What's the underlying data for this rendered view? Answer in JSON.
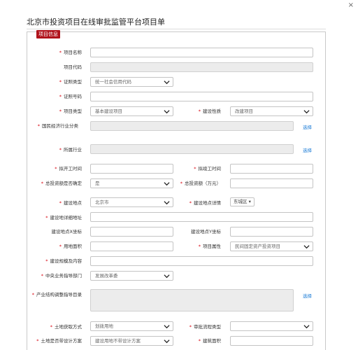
{
  "page_title": "北京市投资项目在线审批监管平台项目单",
  "section_tag": "项目信息",
  "close_label": "×",
  "fields": {
    "project_name": {
      "label": "项目名称",
      "value": ""
    },
    "project_code": {
      "label": "项目代码",
      "value": ""
    },
    "cert_type": {
      "label": "证照类型",
      "value": "统一社会信用代码"
    },
    "cert_no": {
      "label": "证照号码",
      "value": ""
    },
    "project_type": {
      "label": "项目类型",
      "value": "基本建设项目"
    },
    "build_nature": {
      "label": "建设性质",
      "value": "改建项目"
    },
    "industry_class": {
      "label": "国民经济行业分类",
      "value": "",
      "action": "选择"
    },
    "belong_industry": {
      "label": "所属行业",
      "value": "",
      "action": "选择"
    },
    "start_time": {
      "label": "拟开工时间",
      "value": ""
    },
    "finish_time": {
      "label": "拟竣工时间",
      "value": ""
    },
    "invest_confirmed": {
      "label": "总投资额是否确定",
      "value": "是"
    },
    "total_invest": {
      "label": "总投资额（万元）",
      "value": ""
    },
    "location": {
      "label": "建设地点",
      "value": "北京市"
    },
    "location_detail": {
      "label": "建设地点详情",
      "value": "东城区"
    },
    "address": {
      "label": "建设地详细地址",
      "value": ""
    },
    "x_coord": {
      "label": "建设地点X坐标",
      "value": ""
    },
    "y_coord": {
      "label": "建设地点Y坐标",
      "value": ""
    },
    "land_area": {
      "label": "用地面积",
      "value": ""
    },
    "project_attr": {
      "label": "项目属性",
      "value": "民间固定资产投资项目"
    },
    "scale_content": {
      "label": "建设规模及内容",
      "value": ""
    },
    "central_dept": {
      "label": "中央业务指导部门",
      "value": "发展改革委"
    },
    "industry_policy": {
      "label": "产业结构调整指导目录",
      "value": "",
      "action": "选择"
    },
    "land_method": {
      "label": "土地获取方式",
      "value": "划拨用地"
    },
    "approval_type": {
      "label": "审批流程类型",
      "value": ""
    },
    "land_design": {
      "label": "土地是否带设计方案",
      "value": "建设用地不带设计方案"
    },
    "build_area": {
      "label": "建筑面积",
      "value": ""
    }
  }
}
